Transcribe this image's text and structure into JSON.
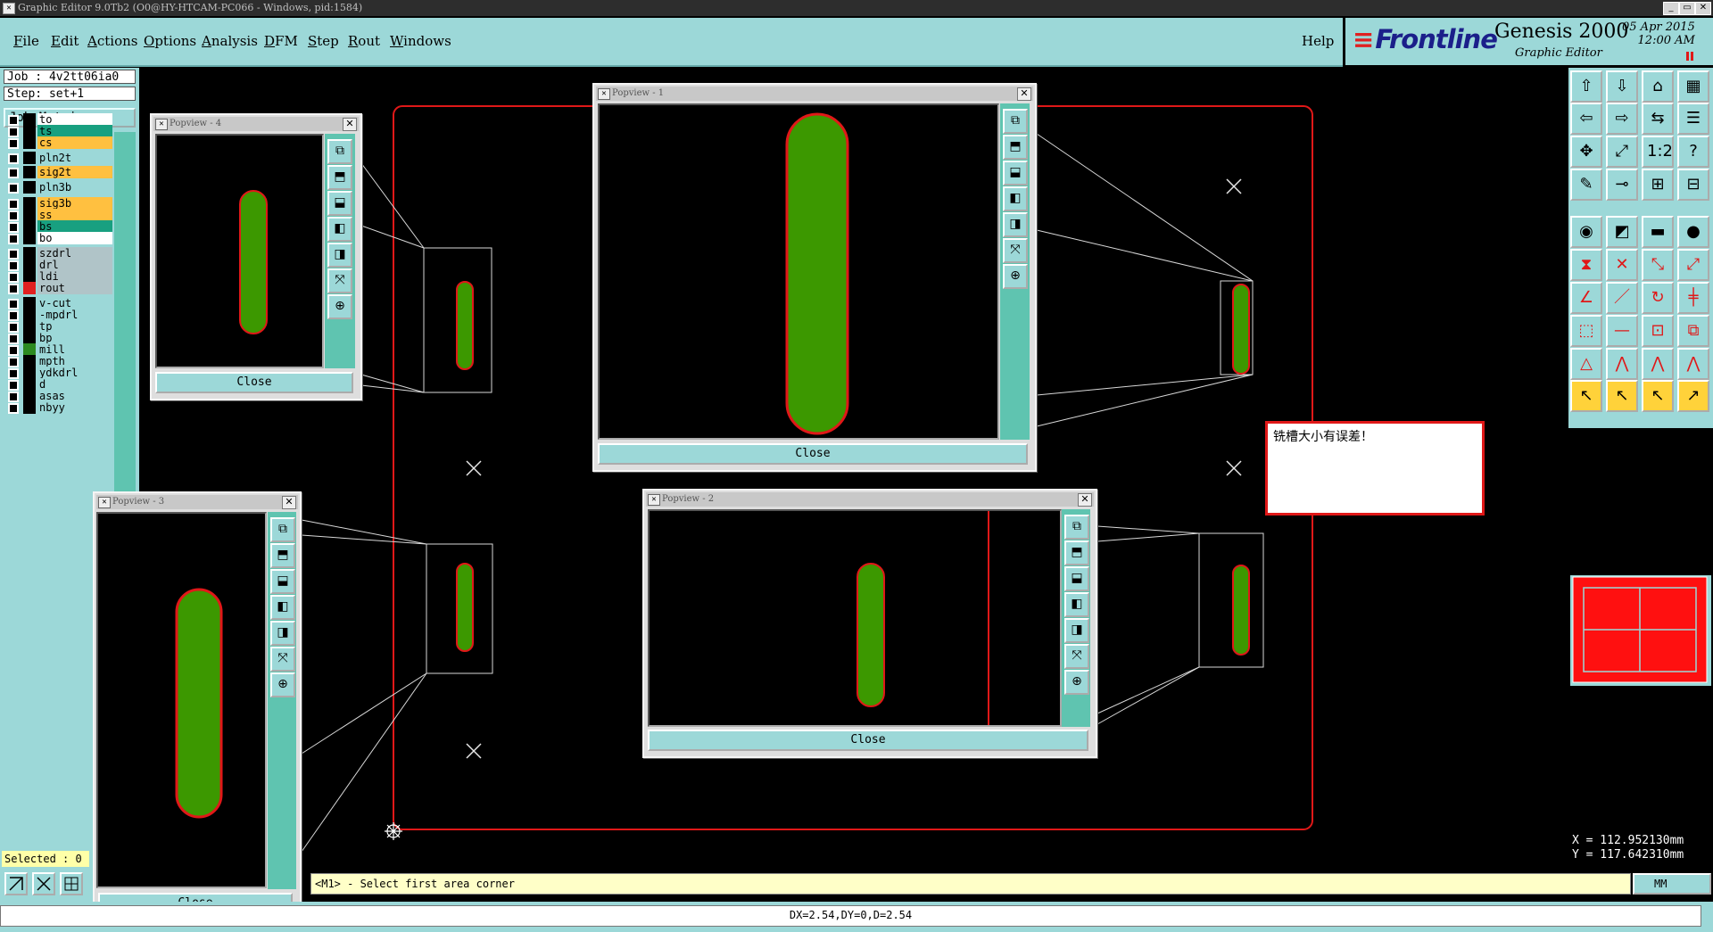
{
  "window": {
    "title": "Graphic Editor 9.0Tb2 (O0@HY-HTCAM-PC066 - Windows, pid:1584)"
  },
  "menu": {
    "items": [
      "File",
      "Edit",
      "Actions",
      "Options",
      "Analysis",
      "DFM",
      "Step",
      "Rout",
      "Windows"
    ],
    "help": "Help"
  },
  "brand": {
    "logo": "Frontline",
    "product": "Genesis 2000",
    "subtitle": "Graphic Editor",
    "date": "05 Apr 2015",
    "time": "12:00 AM"
  },
  "left": {
    "job": "Job : 4v2tt06ia0",
    "step": "Step: set+1",
    "job_matrix": "Job Matrix ...",
    "selected": "Selected : 0",
    "layers": [
      {
        "name": "to",
        "color": "#ffffff",
        "swatch": "#000000"
      },
      {
        "name": "ts",
        "color": "#18a080",
        "swatch": "#000000"
      },
      {
        "name": "cs",
        "color": "#ffc040",
        "swatch": "#000000"
      },
      {
        "name": "pln2t",
        "color": "#9cd8d8",
        "swatch": "#000000"
      },
      {
        "name": "sig2t",
        "color": "#ffc040",
        "swatch": "#000000"
      },
      {
        "name": "pln3b",
        "color": "#9cd8d8",
        "swatch": "#000000"
      },
      {
        "name": "sig3b",
        "color": "#ffc040",
        "swatch": "#000000"
      },
      {
        "name": "ss",
        "color": "#ffc040",
        "swatch": "#000000"
      },
      {
        "name": "bs",
        "color": "#18a080",
        "swatch": "#000000"
      },
      {
        "name": "bo",
        "color": "#ffffff",
        "swatch": "#000000"
      },
      {
        "name": "szdrl",
        "color": "#b0c4c8",
        "swatch": "#000000"
      },
      {
        "name": "drl",
        "color": "#b0c4c8",
        "swatch": "#000000"
      },
      {
        "name": "ldi",
        "color": "#b0c4c8",
        "swatch": "#000000"
      },
      {
        "name": "rout",
        "color": "#b0c4c8",
        "swatch": "#e02020"
      },
      {
        "name": "v-cut",
        "color": "#9cd8d8",
        "swatch": "#000000"
      },
      {
        "name": "-mpdrl",
        "color": "#9cd8d8",
        "swatch": "#000000"
      },
      {
        "name": "tp",
        "color": "#9cd8d8",
        "swatch": "#000000"
      },
      {
        "name": "bp",
        "color": "#9cd8d8",
        "swatch": "#000000"
      },
      {
        "name": "mill",
        "color": "#9cd8d8",
        "swatch": "#2c8a20"
      },
      {
        "name": "mpth",
        "color": "#9cd8d8",
        "swatch": "#000000"
      },
      {
        "name": "ydkdrl",
        "color": "#9cd8d8",
        "swatch": "#000000"
      },
      {
        "name": "d",
        "color": "#9cd8d8",
        "swatch": "#000000"
      },
      {
        "name": "asas",
        "color": "#9cd8d8",
        "swatch": "#000000"
      },
      {
        "name": "nbyy",
        "color": "#9cd8d8",
        "swatch": "#000000"
      }
    ]
  },
  "popviews": [
    {
      "title": "Popview - 1",
      "close": "Close"
    },
    {
      "title": "Popview - 2",
      "close": "Close"
    },
    {
      "title": "Popview - 3",
      "close": "Close"
    },
    {
      "title": "Popview - 4",
      "close": "Close"
    }
  ],
  "message": "铣槽大小有误差！",
  "status": {
    "prompt": "<M1> - Select first area corner",
    "units": "MM",
    "measure": "DX=2.54,DY=0,D=2.54"
  },
  "coords": {
    "x": "X  =  112.952130mm",
    "y": "Y  =  117.642310mm"
  },
  "colors": {
    "panel": "#9cd8d8",
    "feature_fill": "#3c9800",
    "outline": "#e01818",
    "canvas": "#000000"
  }
}
